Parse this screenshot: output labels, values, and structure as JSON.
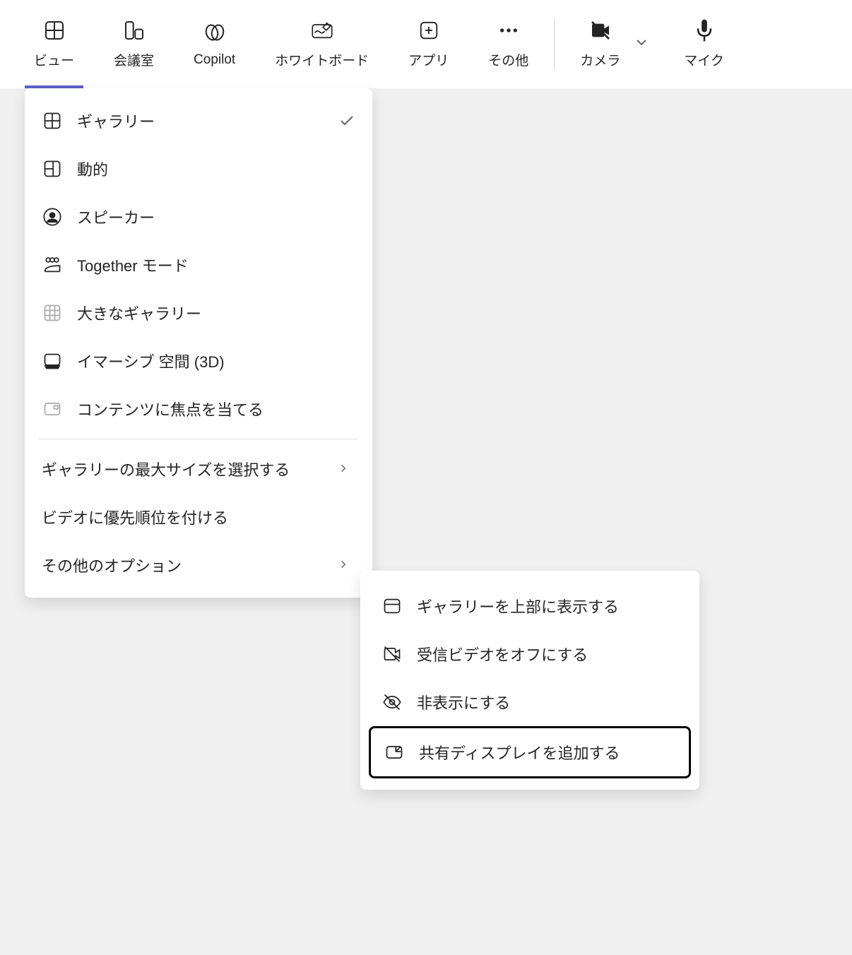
{
  "toolbar": {
    "items": [
      {
        "label": "ビュー",
        "icon": "grid-icon",
        "active": true
      },
      {
        "label": "会議室",
        "icon": "rooms-icon"
      },
      {
        "label": "Copilot",
        "icon": "copilot-icon"
      },
      {
        "label": "ホワイトボード",
        "icon": "whiteboard-icon"
      },
      {
        "label": "アプリ",
        "icon": "apps-icon"
      },
      {
        "label": "その他",
        "icon": "more-icon"
      }
    ],
    "camera": {
      "label": "カメラ"
    },
    "mic": {
      "label": "マイク"
    }
  },
  "dropdown": {
    "items": [
      {
        "label": "ギャラリー",
        "icon": "gallery-icon",
        "checked": true
      },
      {
        "label": "動的",
        "icon": "dynamic-icon"
      },
      {
        "label": "スピーカー",
        "icon": "speaker-icon"
      },
      {
        "label": "Together モード",
        "icon": "together-icon"
      },
      {
        "label": "大きなギャラリー",
        "icon": "large-gallery-icon",
        "faded": true
      },
      {
        "label": "イマーシブ 空間 (3D)",
        "icon": "immersive-icon"
      },
      {
        "label": "コンテンツに焦点を当てる",
        "icon": "focus-content-icon",
        "faded": true
      }
    ],
    "subItems": [
      {
        "label": "ギャラリーの最大サイズを選択する",
        "chevron": true
      },
      {
        "label": "ビデオに優先順位を付ける"
      },
      {
        "label": "その他のオプション",
        "chevron": true
      }
    ]
  },
  "submenu": {
    "items": [
      {
        "label": "ギャラリーを上部に表示する",
        "icon": "top-gallery-icon"
      },
      {
        "label": "受信ビデオをオフにする",
        "icon": "video-off-icon"
      },
      {
        "label": "非表示にする",
        "icon": "hide-icon"
      },
      {
        "label": "共有ディスプレイを追加する",
        "icon": "add-display-icon",
        "selected": true
      }
    ]
  }
}
